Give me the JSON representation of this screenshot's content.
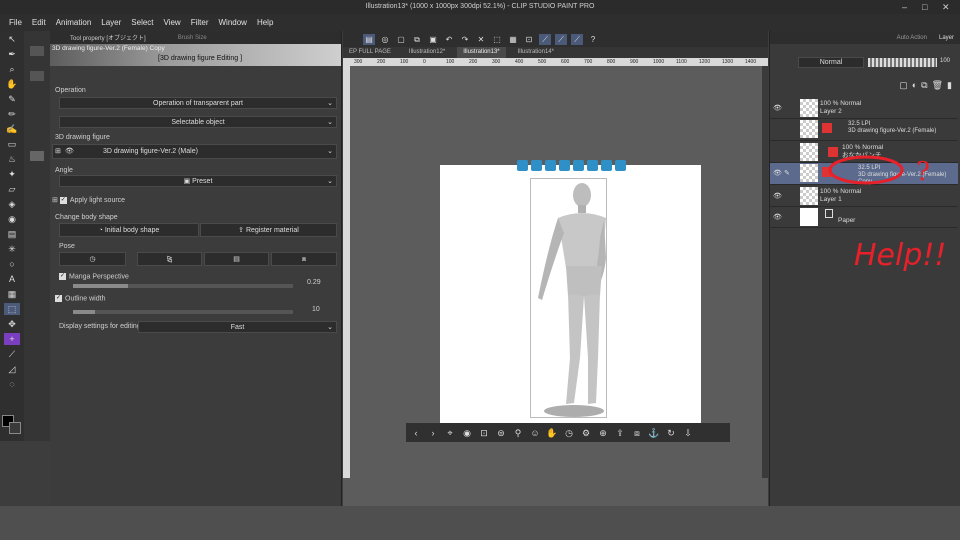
{
  "window": {
    "title": "Illustration13* (1000 x 1000px 300dpi 52.1%) - CLIP STUDIO PAINT PRO",
    "controls": [
      "–",
      "□",
      "✕"
    ]
  },
  "menu": [
    "File",
    "Edit",
    "Animation",
    "Layer",
    "Select",
    "View",
    "Filter",
    "Window",
    "Help"
  ],
  "tool_property": {
    "tab1": "Tool property [オブジェクト]",
    "tab2": "Brush Size",
    "banner_title": "3D drawing figure-Ver.2 (Female) Copy",
    "banner_mode": "[3D drawing figure Editing ]",
    "operation_label": "Operation",
    "operation_value": "Operation of transparent part",
    "selectable_value": "Selectable object",
    "figure_label": "3D drawing figure",
    "figure_value": "3D drawing figure-Ver.2 (Male)",
    "angle_label": "Angle",
    "angle_value": "Preset",
    "light_label": "Apply light source",
    "body_shape_label": "Change body shape",
    "initial_body_btn": "Initial body shape",
    "register_btn": "Register material",
    "pose_label": "Pose",
    "manga_label": "Manga Perspective",
    "manga_value": "0.29",
    "manga_fraction": 0.25,
    "outline_label": "Outline width",
    "outline_value": "10",
    "outline_fraction": 0.1,
    "display_label": "Display settings for editing",
    "display_value": "Fast"
  },
  "canvas": {
    "tabs": [
      "EP FULL PAGE",
      "Illustration12*",
      "Illustration13*",
      "Illustration14*"
    ],
    "ruler": [
      "300",
      "200",
      "100",
      "0",
      "100",
      "200",
      "300",
      "400",
      "500",
      "600",
      "700",
      "800",
      "900",
      "1000",
      "1100",
      "1200",
      "1300",
      "1400"
    ]
  },
  "layers": {
    "tabs": [
      "Auto Action",
      "Layer"
    ],
    "blend": "Normal",
    "opacity": "100",
    "rows": [
      {
        "line1": "100 % Normal",
        "line2": "Layer 2"
      },
      {
        "line1": "32.5 LPI",
        "line2": "3D drawing figure-Ver.2 (Female)"
      },
      {
        "line1": "100 % Normal",
        "line2": "おなかパンチ"
      },
      {
        "line1": "32.5 LPI",
        "line2": "3D drawing figure-Ver.2 (Female) Copy"
      },
      {
        "line1": "100 % Normal",
        "line2": "Layer 1"
      },
      {
        "line1": "",
        "line2": "Paper"
      }
    ]
  },
  "annotation": {
    "text": "Help!!",
    "mark": "?"
  },
  "colors": {
    "accent": "#5b6a8d",
    "annotation": "#e8202a"
  }
}
